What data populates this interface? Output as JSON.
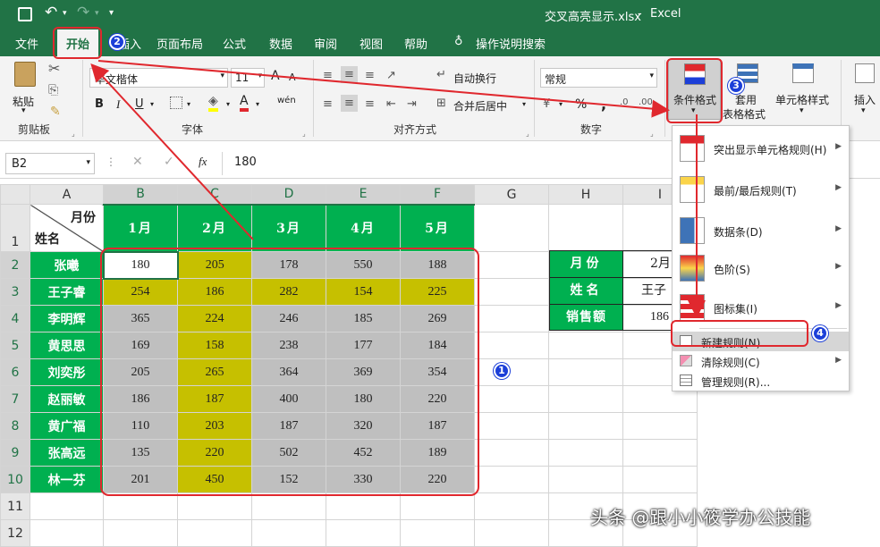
{
  "titlebar": {
    "filename": "交叉高亮显示.xlsx",
    "separator": "-",
    "app": "Excel"
  },
  "tabs": [
    "文件",
    "开始",
    "插入",
    "页面布局",
    "公式",
    "数据",
    "审阅",
    "视图",
    "帮助"
  ],
  "tell_me": "操作说明搜索",
  "ribbon": {
    "clipboard": {
      "paste": "粘贴",
      "group": "剪贴板"
    },
    "font": {
      "name": "华文楷体",
      "size": "11",
      "group": "字体",
      "bold": "B",
      "italic": "I",
      "underline": "U",
      "grow": "A",
      "shrink": "A",
      "font_color": "A",
      "phonetic": "wén"
    },
    "alignment": {
      "wrap": "自动换行",
      "merge": "合并后居中",
      "group": "对齐方式"
    },
    "number": {
      "format": "常规",
      "percent": "%",
      "comma": ",",
      "group": "数字"
    },
    "styles": {
      "conditional": "条件格式",
      "table_1": "套用",
      "table_2": "表格格式",
      "cell_styles": "单元格样式"
    },
    "cells": {
      "insert": "插入"
    }
  },
  "formula_bar": {
    "namebox": "B2",
    "fx": "fx",
    "value": "180"
  },
  "grid": {
    "columns": [
      "A",
      "B",
      "C",
      "D",
      "E",
      "F",
      "G",
      "H",
      "I"
    ],
    "rows": [
      "1",
      "2",
      "3",
      "4",
      "5",
      "6",
      "7",
      "8",
      "9",
      "10",
      "11",
      "12"
    ],
    "corner_top": "月份",
    "corner_bottom": "姓名",
    "months": [
      "1月",
      "2月",
      "3月",
      "4月",
      "5月"
    ],
    "names": [
      "张曦",
      "王子睿",
      "李明辉",
      "黄思思",
      "刘奕彤",
      "赵丽敏",
      "黄广福",
      "张高远",
      "林一芬"
    ],
    "values": [
      [
        "180",
        "205",
        "178",
        "550",
        "188"
      ],
      [
        "254",
        "186",
        "282",
        "154",
        "225"
      ],
      [
        "365",
        "224",
        "246",
        "185",
        "269"
      ],
      [
        "169",
        "158",
        "238",
        "177",
        "184"
      ],
      [
        "205",
        "265",
        "364",
        "369",
        "354"
      ],
      [
        "186",
        "187",
        "400",
        "180",
        "220"
      ],
      [
        "110",
        "203",
        "187",
        "320",
        "187"
      ],
      [
        "135",
        "220",
        "502",
        "452",
        "189"
      ],
      [
        "201",
        "450",
        "152",
        "330",
        "220"
      ]
    ]
  },
  "side_table": {
    "labels": [
      "月份",
      "姓名",
      "销售额"
    ],
    "values": [
      "2月",
      "王子",
      "186"
    ]
  },
  "cf_menu": {
    "items": [
      "突出显示单元格规则(H)",
      "最前/最后规则(T)",
      "数据条(D)",
      "色阶(S)",
      "图标集(I)"
    ],
    "small_items": [
      "新建规则(N)...",
      "清除规则(C)",
      "管理规则(R)..."
    ]
  },
  "badges": [
    "1",
    "2",
    "3",
    "4"
  ],
  "watermark": "头条 @跟小小筱学办公技能",
  "colors": {
    "excel_green": "#217346",
    "header_green": "#00b050",
    "highlight_yellow": "#c6c000",
    "gray_fill": "#bfbfbf",
    "annotation_red": "#e0282e",
    "badge_blue": "#1c3fd8"
  }
}
